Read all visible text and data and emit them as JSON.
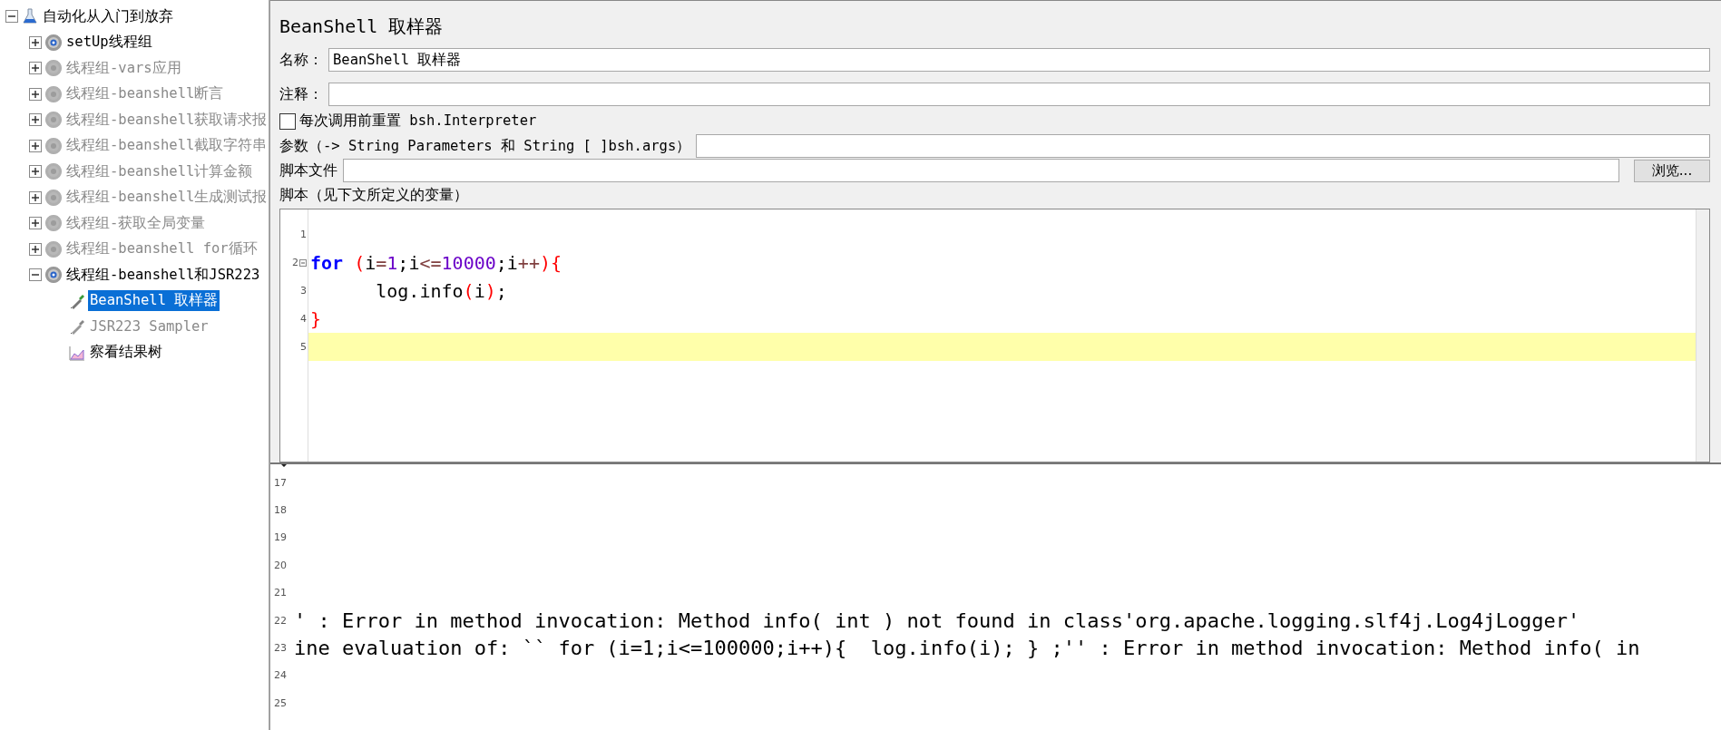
{
  "tree": {
    "label": "自动化从入门到放弃",
    "kind": "plan",
    "expanded": true,
    "enabled": true,
    "selected": false,
    "children": [
      {
        "label": "setUp线程组",
        "kind": "group",
        "expanded": false,
        "enabled": true,
        "selected": false
      },
      {
        "label": "线程组-vars应用",
        "kind": "group",
        "expanded": false,
        "enabled": false,
        "selected": false
      },
      {
        "label": "线程组-beanshell断言",
        "kind": "group",
        "expanded": false,
        "enabled": false,
        "selected": false
      },
      {
        "label": "线程组-beanshell获取请求报",
        "kind": "group",
        "expanded": false,
        "enabled": false,
        "selected": false
      },
      {
        "label": "线程组-beanshell截取字符串",
        "kind": "group",
        "expanded": false,
        "enabled": false,
        "selected": false
      },
      {
        "label": "线程组-beanshell计算金额",
        "kind": "group",
        "expanded": false,
        "enabled": false,
        "selected": false
      },
      {
        "label": "线程组-beanshell生成测试报",
        "kind": "group",
        "expanded": false,
        "enabled": false,
        "selected": false
      },
      {
        "label": "线程组-获取全局变量",
        "kind": "group",
        "expanded": false,
        "enabled": false,
        "selected": false
      },
      {
        "label": "线程组-beanshell for循环",
        "kind": "group",
        "expanded": false,
        "enabled": false,
        "selected": false
      },
      {
        "label": "线程组-beanshell和JSR223",
        "kind": "group",
        "expanded": true,
        "enabled": true,
        "selected": false,
        "children": [
          {
            "label": "BeanShell 取样器",
            "kind": "sampler",
            "enabled": true,
            "selected": true
          },
          {
            "label": "JSR223 Sampler",
            "kind": "sampler",
            "enabled": false,
            "selected": false
          },
          {
            "label": "察看结果树",
            "kind": "listener",
            "enabled": true,
            "selected": false
          }
        ]
      }
    ]
  },
  "form": {
    "title": "BeanShell 取样器",
    "name": {
      "label": "名称：",
      "value": "BeanShell 取样器"
    },
    "comment": {
      "label": "注释："
    },
    "reset_checkbox": {
      "label": "每次调用前重置 bsh.Interpreter",
      "checked": false
    },
    "parameters": {
      "label": "参数（-> String Parameters 和 String [ ]bsh.args）"
    },
    "script_file": {
      "label": "脚本文件",
      "button": "浏览..."
    },
    "script_label": "脚本（见下文所定义的变量）"
  },
  "editor": {
    "lines": [
      {
        "number": "1",
        "current": false,
        "foldable": false
      },
      {
        "number": "2",
        "current": false,
        "foldable": true,
        "tokens": [
          {
            "kind": "keyword",
            "text": "for"
          },
          {
            "kind": "paren",
            "text": " ("
          },
          {
            "kind": "plain",
            "text": "i"
          },
          {
            "kind": "operator",
            "text": "="
          },
          {
            "kind": "number",
            "text": "1"
          },
          {
            "kind": "plain",
            "text": ";i"
          },
          {
            "kind": "operator",
            "text": "<="
          },
          {
            "kind": "number",
            "text": "10000"
          },
          {
            "kind": "plain",
            "text": ";i"
          },
          {
            "kind": "operator",
            "text": "++"
          },
          {
            "kind": "paren",
            "text": "){"
          }
        ]
      },
      {
        "number": "3",
        "current": false,
        "foldable": false,
        "tokens": [
          {
            "kind": "plain",
            "text": "      log.info"
          },
          {
            "kind": "paren",
            "text": "("
          },
          {
            "kind": "plain",
            "text": "i"
          },
          {
            "kind": "paren",
            "text": ")"
          },
          {
            "kind": "plain",
            "text": ";"
          }
        ]
      },
      {
        "number": "4",
        "current": false,
        "foldable": false,
        "tokens": [
          {
            "kind": "paren",
            "text": "}"
          }
        ]
      },
      {
        "number": "5",
        "current": true,
        "foldable": false
      }
    ]
  },
  "log": {
    "lines": [
      {
        "number": "17"
      },
      {
        "number": "18"
      },
      {
        "number": "19"
      },
      {
        "number": "20"
      },
      {
        "number": "21"
      },
      {
        "number": "22",
        "text": "' : Error in method invocation: Method info( int ) not found in class'org.apache.logging.slf4j.Log4jLogger'"
      },
      {
        "number": "23",
        "text": "ine evaluation of: `` for (i=1;i<=100000;i++){  log.info(i); } ;'' : Error in method invocation: Method info( in"
      },
      {
        "number": "24"
      },
      {
        "number": "25"
      }
    ]
  }
}
